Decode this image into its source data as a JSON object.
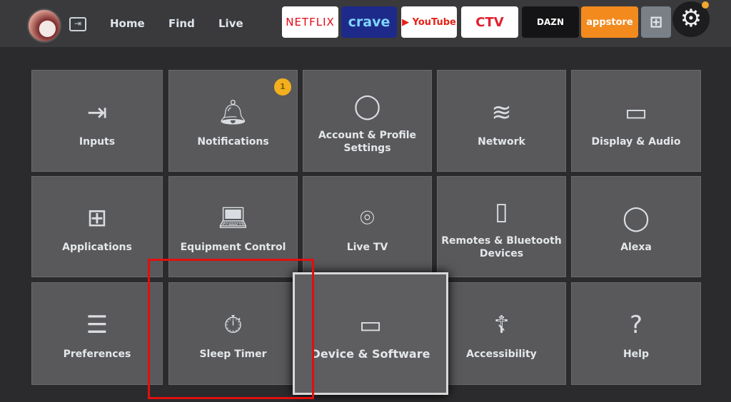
{
  "topbar": {
    "nav": [
      "Home",
      "Find",
      "Live"
    ],
    "apps": [
      {
        "label": "NETFLIX",
        "bg": "#ffffff",
        "fg": "#e50914"
      },
      {
        "label": "crave",
        "bg": "#1e2a8a",
        "fg": "#7fd6ff"
      },
      {
        "label": "▶ YouTube",
        "bg": "#ffffff",
        "fg": "#e62117"
      },
      {
        "label": "CTV",
        "bg": "#ffffff",
        "fg": "#e02030"
      },
      {
        "label": "DAZN",
        "bg": "#141416",
        "fg": "#ffffff"
      },
      {
        "label": "appstore",
        "bg": "#f28a1e",
        "fg": "#ffffff"
      }
    ],
    "notification_dot_color": "#f0a830"
  },
  "tiles": [
    {
      "label": "Inputs",
      "icon": "input-icon",
      "glyph": "⇥"
    },
    {
      "label": "Notifications",
      "icon": "bell-icon",
      "glyph": "🔔︎",
      "badge": "1"
    },
    {
      "label": "Account & Profile Settings",
      "icon": "profile-icon",
      "glyph": "◯"
    },
    {
      "label": "Network",
      "icon": "wifi-icon",
      "glyph": "≋"
    },
    {
      "label": "Display & Audio",
      "icon": "display-icon",
      "glyph": "▭"
    },
    {
      "label": "Applications",
      "icon": "apps-icon",
      "glyph": "⊞"
    },
    {
      "label": "Equipment Control",
      "icon": "laptop-icon",
      "glyph": "💻︎"
    },
    {
      "label": "Live TV",
      "icon": "antenna-icon",
      "glyph": "⌾"
    },
    {
      "label": "Remotes & Bluetooth Devices",
      "icon": "remote-icon",
      "glyph": "▯"
    },
    {
      "label": "Alexa",
      "icon": "alexa-icon",
      "glyph": "◯"
    },
    {
      "label": "Preferences",
      "icon": "sliders-icon",
      "glyph": "☰"
    },
    {
      "label": "Sleep Timer",
      "icon": "stopwatch-icon",
      "glyph": "⏱︎"
    },
    {
      "label": "Device & Software",
      "icon": "tv-icon",
      "glyph": "▭"
    },
    {
      "label": "Accessibility",
      "icon": "accessibility-icon",
      "glyph": "☦︎"
    },
    {
      "label": "Help",
      "icon": "help-icon",
      "glyph": "?"
    }
  ],
  "focused_tile": "Device & Software",
  "highlight_color": "#e01010"
}
